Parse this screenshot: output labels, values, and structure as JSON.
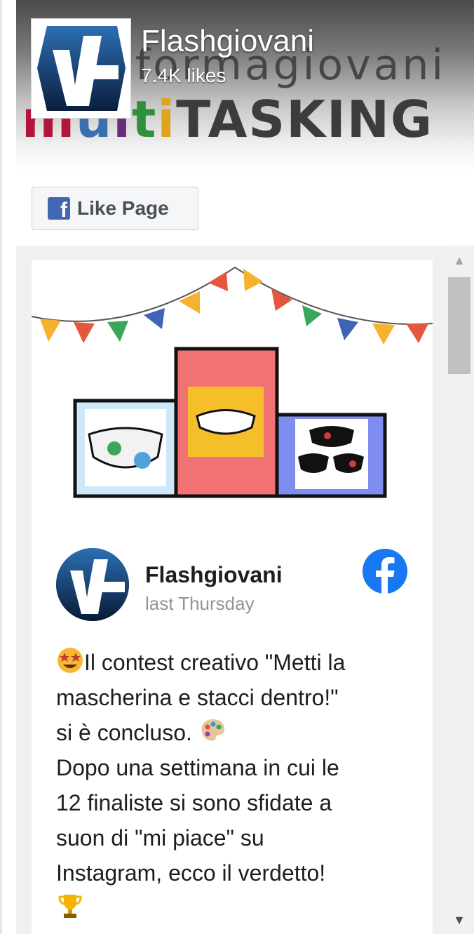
{
  "page": {
    "name": "Flashgiovani",
    "likes": "7.4K likes",
    "cover_words": {
      "top": "formagiovani",
      "bottom_colored": [
        "m",
        "u",
        "l",
        "t",
        "i"
      ],
      "bottom_rest": "TASKING"
    }
  },
  "like_button": {
    "label": "Like Page",
    "icon_glyph": "f",
    "icon": "facebook-square-icon"
  },
  "post": {
    "author": "Flashgiovani",
    "time": "last Thursday",
    "text_lines": [
      "Il contest creativo \"Metti la",
      "mascherina e stacci dentro!\"",
      "si è concluso.",
      "Dopo una settimana in cui le",
      "12 finaliste si sono sfidate a",
      "suon di \"mi piace\" su",
      "Instagram, ecco il verdetto!"
    ],
    "icons": [
      "star-struck-emoji-icon",
      "palette-emoji-icon",
      "trophy-emoji-icon",
      "facebook-round-icon"
    ]
  },
  "scrollbar": {
    "up_glyph": "▲",
    "down_glyph": "▼"
  },
  "colors": {
    "facebook_blue": "#1877f2",
    "like_icon_blue": "#4267b2",
    "muted_text": "#90949c"
  }
}
